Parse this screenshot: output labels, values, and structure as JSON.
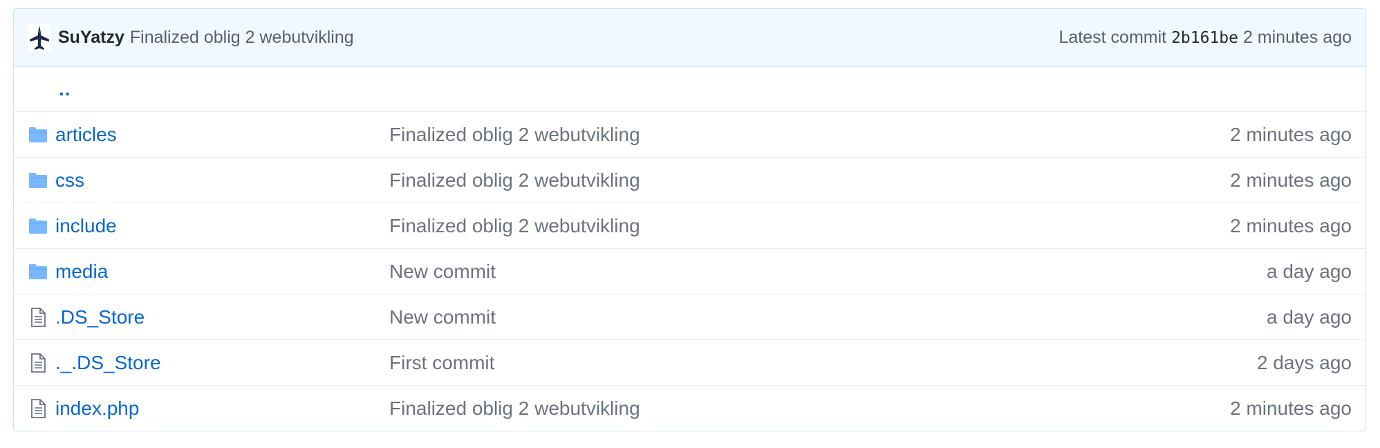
{
  "latest_commit": {
    "author": "SuYatzy",
    "message": "Finalized oblig 2 webutvikling",
    "label": "Latest commit",
    "sha": "2b161be",
    "age": "2 minutes ago",
    "avatar_icon": "fighter-jet-avatar-icon"
  },
  "parent_dir_label": "..",
  "colors": {
    "link": "#0366d6",
    "muted": "#6a737d",
    "header_bg": "#f1f8ff",
    "header_border": "#c8e1ff",
    "folder_icon": "#79b8ff"
  },
  "entries": [
    {
      "type": "folder",
      "icon": "folder-icon",
      "name": "articles",
      "message": "Finalized oblig 2 webutvikling",
      "age": "2 minutes ago"
    },
    {
      "type": "folder",
      "icon": "folder-icon",
      "name": "css",
      "message": "Finalized oblig 2 webutvikling",
      "age": "2 minutes ago"
    },
    {
      "type": "folder",
      "icon": "folder-icon",
      "name": "include",
      "message": "Finalized oblig 2 webutvikling",
      "age": "2 minutes ago"
    },
    {
      "type": "folder",
      "icon": "folder-icon",
      "name": "media",
      "message": "New commit",
      "age": "a day ago"
    },
    {
      "type": "file",
      "icon": "file-icon",
      "name": ".DS_Store",
      "message": "New commit",
      "age": "a day ago"
    },
    {
      "type": "file",
      "icon": "file-icon",
      "name": "._.DS_Store",
      "message": "First commit",
      "age": "2 days ago"
    },
    {
      "type": "file",
      "icon": "file-icon",
      "name": "index.php",
      "message": "Finalized oblig 2 webutvikling",
      "age": "2 minutes ago"
    }
  ]
}
